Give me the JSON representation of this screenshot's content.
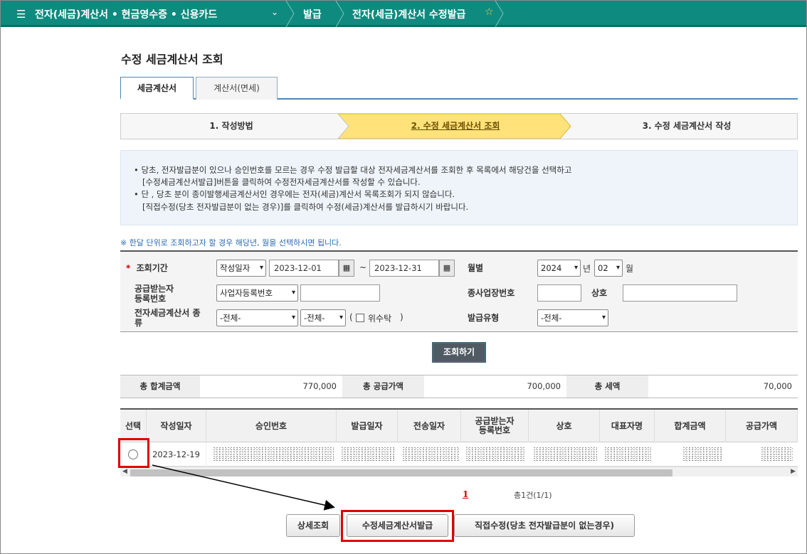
{
  "nav": {
    "section": "전자(세금)계산서 • 현금영수증 • 신용카드",
    "crumb_issue": "발급",
    "crumb_page": "전자(세금)계산서 수정발급"
  },
  "page_title": "수정 세금계산서 조회",
  "tabs": [
    {
      "label": "세금계산서",
      "active": true
    },
    {
      "label": "계산서(면세)",
      "active": false
    }
  ],
  "steps": [
    {
      "label": "1. 작성방법"
    },
    {
      "label": "2. 수정 세금계산서 조회"
    },
    {
      "label": "3. 수정 세금계산서 작성"
    }
  ],
  "info_lines": [
    "• 당초, 전자발급분이 있으나 승인번호를 모르는 경우 수정 발급할 대상 전자세금계산서를 조회한 후 목록에서 해당건을 선택하고",
    "[수정세금계산서발급]버튼을 클릭하여 수정전자세금계산서를 작성할 수 있습니다.",
    "• 단 , 당초 분이 종이발행세금계산서인 경우에는 전자(세금)계산서 목록조회가 되지 않습니다.",
    "[직접수정(당초 전자발급분이 없는 경우)]를 클릭하여 수정(세금)계산서를 발급하시기 바랍니다."
  ],
  "note": "※ 한달 단위로 조회하고자 할 경우 해당년, 월을 선택하시면 됩니다.",
  "form": {
    "period_label": "조회기간",
    "period_type": "작성일자",
    "date_from": "2023-12-01",
    "date_to": "2023-12-31",
    "tilde": "~",
    "month_label": "월별",
    "year": "2024",
    "year_unit": "년",
    "month": "02",
    "month_unit": "월",
    "recipient_label": "공급받는자 등록번호",
    "recipient_type": "사업자등록번호",
    "recipient_value": "",
    "branch_label": "종사업장번호",
    "branch_value": "",
    "trade_name_label": "상호",
    "trade_name_value": "",
    "kind_label": "전자세금계산서 종류",
    "kind1": "-전체-",
    "kind2": "-전체-",
    "consign_open": "(",
    "consign_label": "위수탁",
    "consign_close": ")",
    "issue_type_label": "발급유형",
    "issue_type": "-전체-",
    "search_button": "조회하기"
  },
  "totals": [
    {
      "label": "총 합계금액",
      "value": "770,000"
    },
    {
      "label": "총 공급가액",
      "value": "700,000"
    },
    {
      "label": "총 세액",
      "value": "70,000"
    }
  ],
  "table": {
    "headers": [
      "선택",
      "작성일자",
      "승인번호",
      "발급일자",
      "전송일자",
      "공급받는자 등록번호",
      "상호",
      "대표자명",
      "합계금액",
      "공급가액"
    ],
    "rows": [
      {
        "date": "2023-12-19"
      }
    ]
  },
  "pager": {
    "current": "1",
    "total": "총1건(1/1)"
  },
  "buttons": {
    "detail": "상세조회",
    "issue": "수정세금계산서발급",
    "direct": "직접수정(당초 전자발급분이 없는경우)"
  },
  "colors": {
    "nav": "#0f8a7e",
    "active_step": "#ffe27a",
    "highlight": "#e00000"
  }
}
